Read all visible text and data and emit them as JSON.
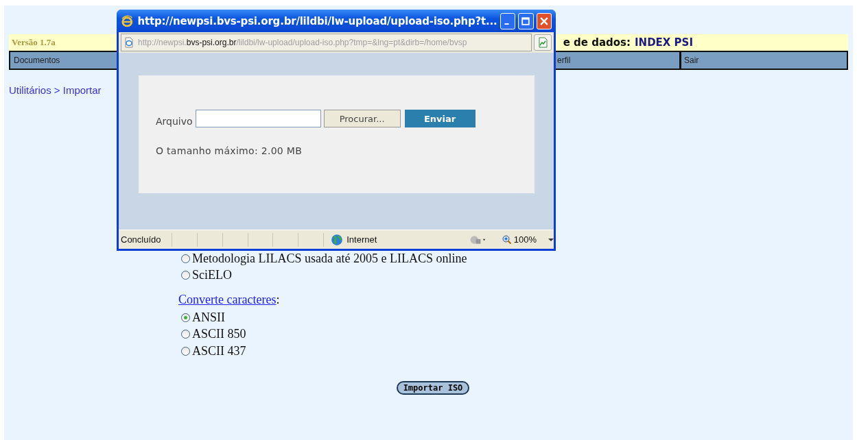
{
  "page": {
    "version": "Versão 1.7a",
    "database_label": "e de dados:",
    "database_name": "INDEX PSI",
    "nav": [
      {
        "label": "Documentos"
      },
      {
        "label": "erfil"
      },
      {
        "label": "Sair"
      }
    ],
    "breadcrumb": "Utilitários > Importar",
    "format_options": [
      {
        "label": "Metodologia LILACS usada até 2005 e LILACS online",
        "selected": false
      },
      {
        "label": "SciELO",
        "selected": false
      }
    ],
    "charset_link": "Converte caracteres",
    "charset_suffix": ":",
    "charset_options": [
      {
        "label": "ANSII",
        "selected": true
      },
      {
        "label": "ASCII 850",
        "selected": false
      },
      {
        "label": "ASCII 437",
        "selected": false
      }
    ],
    "submit": "Importar ISO"
  },
  "popup": {
    "title": "http://newpsi.bvs-psi.org.br/lildbi/lw-upload/upload-iso.php?t...",
    "address": {
      "prefix": "http://newpsi.",
      "domain": "bvs-psi.org.br",
      "rest": "/lildbi/lw-upload/upload-iso.php?tmp=&lng=pt&dirb=/home/bvsp"
    },
    "file_label": "Arquivo",
    "browse_button": "Procurar...",
    "send_button": "Enviar",
    "max_size": "O tamanho máximo: 2.00 MB",
    "status": "Concluído",
    "zone": "Internet",
    "zoom": "100%"
  }
}
